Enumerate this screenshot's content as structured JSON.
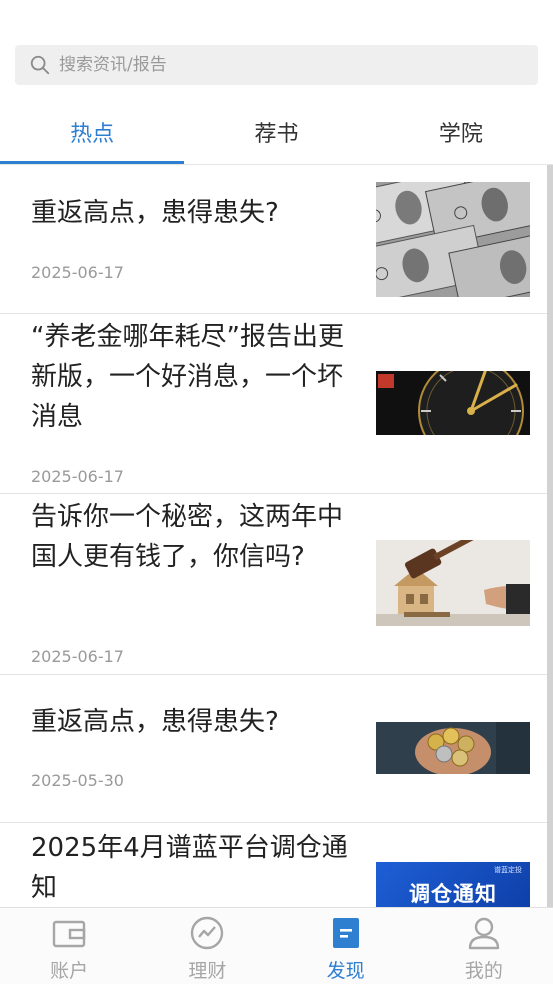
{
  "search": {
    "placeholder": "搜索资讯/报告",
    "icon": "search-icon"
  },
  "tabs": [
    {
      "label": "热点",
      "active": true
    },
    {
      "label": "荐书",
      "active": false
    },
    {
      "label": "学院",
      "active": false
    }
  ],
  "articles": [
    {
      "title": "重返高点，患得患失?",
      "date": "2025-06-17",
      "thumbnail": "dollar-bills-image"
    },
    {
      "title": "“养老金哪年耗尽”报告出更新版，一个好消息，一个坏消息",
      "date": "2025-06-17",
      "thumbnail": "deadline-clock-image"
    },
    {
      "title": "告诉你一个秘密，这两年中国人更有钱了，你信吗?",
      "date": "2025-06-17",
      "thumbnail": "auction-gavel-house-image"
    },
    {
      "title": "重返高点，患得患失?",
      "date": "2025-05-30",
      "thumbnail": "coins-in-hands-image"
    },
    {
      "title": "2025年4月谱蓝平台调仓通知",
      "date": "",
      "thumbnail": "rebalance-notice-image",
      "thumbnail_text": "调仓通知",
      "thumbnail_small_text": "谱蓝定投"
    }
  ],
  "bottom_nav": [
    {
      "label": "账户",
      "icon": "wallet-icon",
      "active": false
    },
    {
      "label": "理财",
      "icon": "trend-chart-icon",
      "active": false
    },
    {
      "label": "发现",
      "icon": "discover-document-icon",
      "active": true
    },
    {
      "label": "我的",
      "icon": "user-profile-icon",
      "active": false
    }
  ],
  "colors": {
    "accent": "#2f7fd1",
    "text": "#222222",
    "muted": "#9a9a9a",
    "search_bg": "#efefef"
  }
}
